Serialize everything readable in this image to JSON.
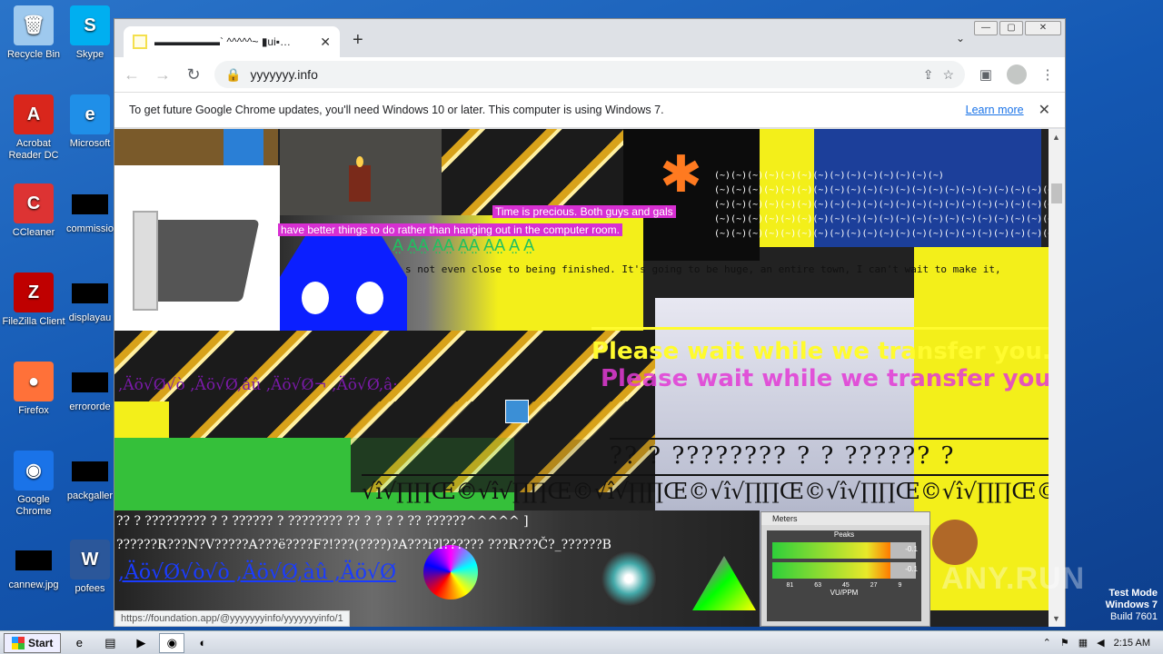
{
  "desktop": {
    "icons": [
      {
        "label": "Recycle Bin",
        "icon": "recycle-bin-icon",
        "color": "#9ec9ee"
      },
      {
        "label": "Skype",
        "icon": "skype-icon",
        "color": "#00aff0"
      },
      {
        "label": "Acrobat Reader DC",
        "icon": "acrobat-icon",
        "color": "#d9261c"
      },
      {
        "label": "Microsoft",
        "icon": "edge-icon",
        "color": "#1f8fe8"
      },
      {
        "label": "CCleaner",
        "icon": "ccleaner-icon",
        "color": "#d33"
      },
      {
        "label": "commissio",
        "icon": "file-icon",
        "color": "#000000"
      },
      {
        "label": "FileZilla Client",
        "icon": "filezilla-icon",
        "color": "#bf0000"
      },
      {
        "label": "displayau",
        "icon": "file-icon",
        "color": "#000000"
      },
      {
        "label": "Firefox",
        "icon": "firefox-icon",
        "color": "#ff7139"
      },
      {
        "label": "errororde",
        "icon": "file-icon",
        "color": "#000000"
      },
      {
        "label": "Google Chrome",
        "icon": "chrome-icon",
        "color": "#1a73e8"
      },
      {
        "label": "packgaller",
        "icon": "file-icon",
        "color": "#000000"
      },
      {
        "label": "cannew.jpg",
        "icon": "image-file-icon",
        "color": "#000000"
      },
      {
        "label": "pofees",
        "icon": "word-icon",
        "color": "#2b579a"
      }
    ]
  },
  "browser": {
    "tab": {
      "title": "▬▬▬▬▬▬` ^^^^^~ ▮ui▪…",
      "close": "✕"
    },
    "new_tab": "+",
    "tab_menu": "⌄",
    "window_buttons": {
      "minimize": "—",
      "restore": "▢",
      "close": "✕"
    },
    "nav": {
      "back": "←",
      "forward": "→",
      "reload": "↻"
    },
    "address": {
      "url": "yyyyyyy.info",
      "lock": "🔒"
    },
    "icons": {
      "share": "⇪",
      "star": "☆",
      "sidepanel": "▣",
      "menu": "⋮"
    },
    "infobar": {
      "message": "To get future Google Chrome updates, you'll need Windows 10 or later. This computer is using Windows 7.",
      "link": "Learn more",
      "close": "✕"
    },
    "status_url": "https://foundation.app/@yyyyyyyinfo/yyyyyyyinfo/1"
  },
  "page": {
    "time_precious_1": "Time is precious. Both guys and gals",
    "time_precious_2": "have better things to do rather than hanging out in the computer room.",
    "green_letters": "A̤ A̤A̤ A̤A̤ A̤A̤ A̤A̤ A̤ A̤",
    "mono_line": "s not even close to being finished. It's going to be huge, an entire town, I can't wait to make it,",
    "faces_block": "(~)(~)(~)(~)(~)(~)(~)(~)(~)(~)(~)(~)(~)(~)\n(~)(~)(~)(~)(~)(~)(~)(~)(~)(~)(~)(~)(~)(~)(~)(~)(~)(~)(~)(~)(~)(~)(~)\n(~)(~)(~)(~)(~)(~)(~)(~)(~)(~)(~)(~)(~)(~)(~)(~)(~)(~)(~)(~)(~)(~)(~)\n(~)(~)(~)(~)(~)(~)(~)(~)(~)(~)(~)(~)(~)(~)(~)(~)(~)(~)(~)(~)(~)(~)(~)\n(~)(~)(~)(~)(~)(~)(~)(~)(~)(~)(~)(~)(~)(~)(~)(~)(~)(~)(~)(~)(~)(~)(~)",
    "wait_text": "Please wait while we transfer you...",
    "wait_text_shadow": "Please wait while we transfer you...",
    "purple_line": ",Äö√Ø√ò ,Äö√Ø,âû ,Äö√Ø¬ ,Äö√Ø,â·",
    "big_q": "?? ?  ???????? ? ? ?????? ?",
    "big_v": "√î√∏∏Œ©√î√∏∏Œ©√î√∏∏Œ©√î√∏∏Œ©√î√∏∏Œ©√î√∏∏Œ©",
    "q_line_1": "?? ? ????????? ? ? ?????? ? ???????? ?? ? ? ? ? ??                    ??????^^^^^ ]",
    "q_line_2": "??????R???N?V?????A???ë????F?!???(????)?A???i?l?????? ???R???Č?_??????B",
    "link_line": ",Äö√Ø√ò√ò ,Äö√Ø,àû ,Äö√Ø",
    "meters": {
      "title": "Meters",
      "peaks_label": "Peaks",
      "bar1_value": "-0.1",
      "bar2_value": "-0.1",
      "bar1_level": 0.82,
      "bar2_level": 0.82,
      "scale": [
        "81",
        "63",
        "45",
        "27",
        "9"
      ],
      "unit": "VU/PPM"
    }
  },
  "overlay": {
    "watermark": "ANY.RUN",
    "test_mode": "Test Mode",
    "os": "Windows 7",
    "build": "Build 7601"
  },
  "taskbar": {
    "start": "Start",
    "apps": [
      {
        "name": "ie",
        "icon": "internet-explorer-icon",
        "glyph": "e"
      },
      {
        "name": "explorer",
        "icon": "folder-icon",
        "glyph": "▤"
      },
      {
        "name": "media",
        "icon": "media-player-icon",
        "glyph": "▶"
      },
      {
        "name": "chrome",
        "icon": "chrome-icon",
        "glyph": "◉"
      },
      {
        "name": "edge",
        "icon": "edge-icon",
        "glyph": "◐"
      }
    ],
    "time": "2:15 AM"
  }
}
